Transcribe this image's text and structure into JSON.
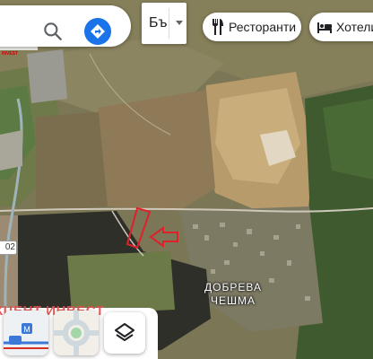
{
  "search": {
    "icon": "search-icon",
    "directions_icon": "directions-icon"
  },
  "language_select": {
    "value": "Бъ"
  },
  "chips": [
    {
      "label": "Ресторанти",
      "icon": "restaurant-icon"
    },
    {
      "label": "Хотели",
      "icon": "hotel-icon"
    }
  ],
  "logo": {
    "text": "CENT",
    "subtext": "INVEST"
  },
  "map": {
    "place_label_line1": "ДОБРЕВА",
    "place_label_line2": "ЧЕШМА",
    "road_shield": "02",
    "watermark": "КЦЕНТ ИНВЕСТ",
    "marker_color": "#e0202a",
    "brand_blue": "#1a73e8"
  },
  "bottom": {
    "transit_tile_icon": "transit-icon",
    "traffic_tile_icon": "roundabout-icon",
    "layers_icon": "layers-icon"
  }
}
